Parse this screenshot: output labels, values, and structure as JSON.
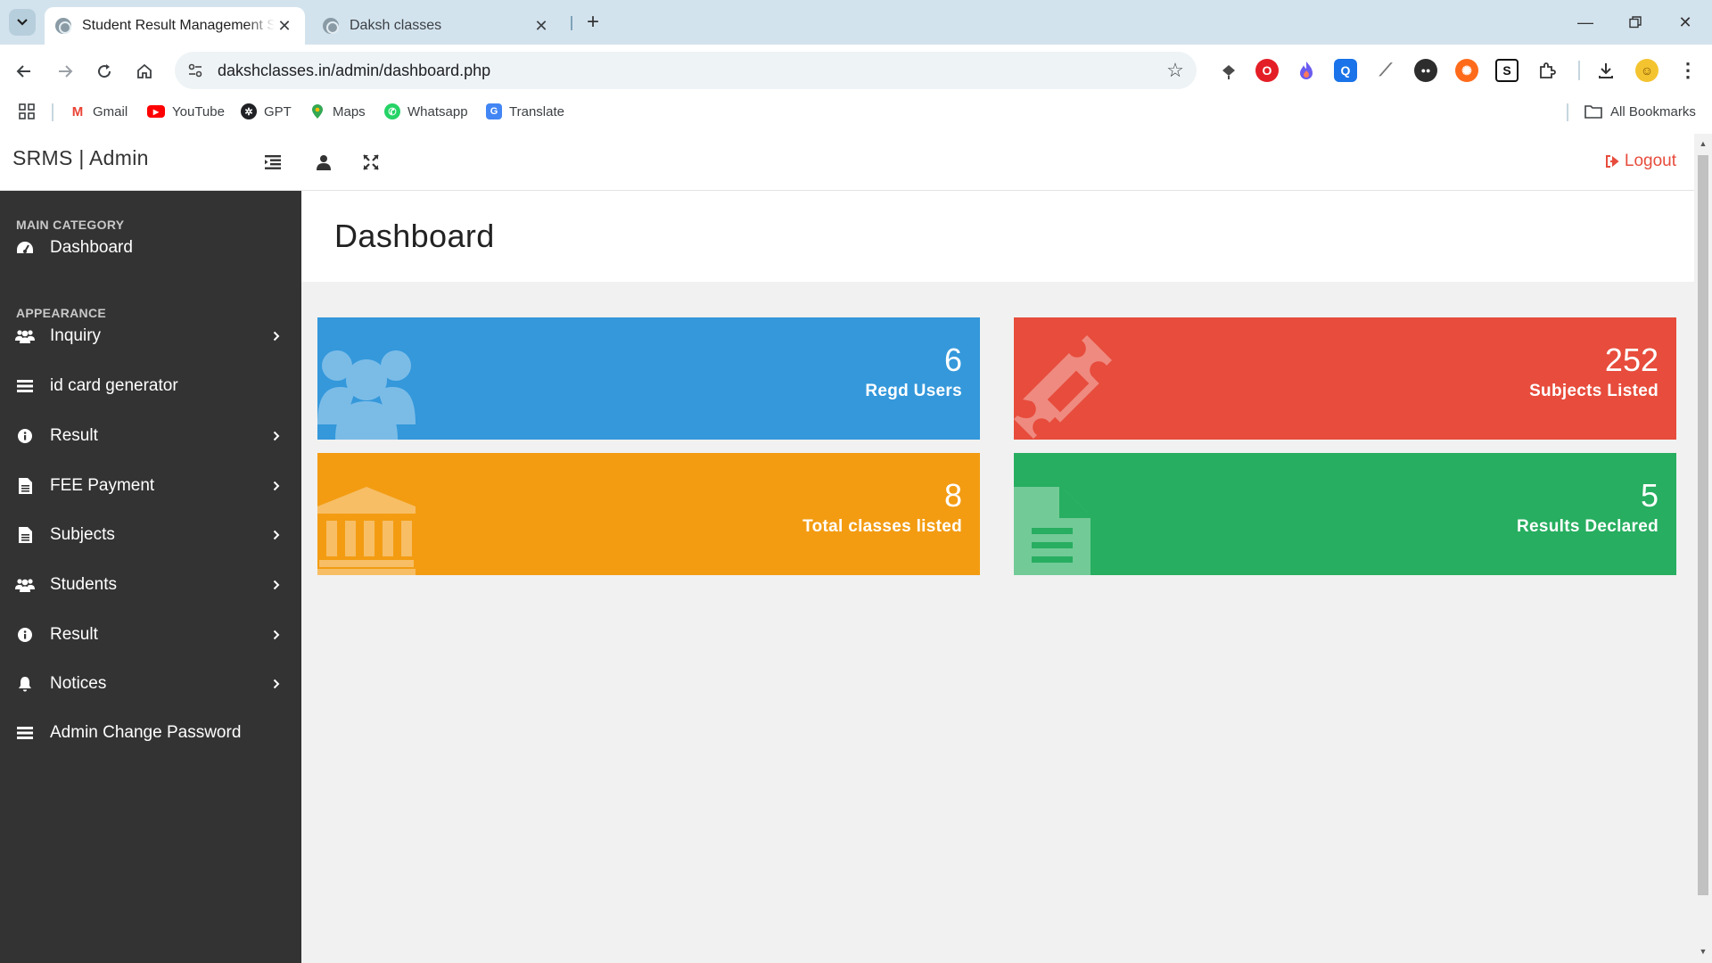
{
  "browser": {
    "tabs": [
      {
        "title": "Student Result Management Sy",
        "active": true
      },
      {
        "title": "Daksh classes",
        "active": false
      }
    ],
    "url": "dakshclasses.in/admin/dashboard.php",
    "bookmarks": [
      {
        "label": "Gmail",
        "icon": "gmail-icon",
        "color": "#ea4335"
      },
      {
        "label": "YouTube",
        "icon": "youtube-icon",
        "color": "#ff0000"
      },
      {
        "label": "GPT",
        "icon": "openai-icon",
        "color": "#202124"
      },
      {
        "label": "Maps",
        "icon": "maps-pin-icon",
        "color": "#34a853"
      },
      {
        "label": "Whatsapp",
        "icon": "whatsapp-icon",
        "color": "#25d366"
      },
      {
        "label": "Translate",
        "icon": "translate-icon",
        "color": "#4285f4"
      }
    ],
    "all_bookmarks": "All Bookmarks"
  },
  "app": {
    "brand": "SRMS | Admin",
    "logout": "Logout",
    "page_title": "Dashboard"
  },
  "sidebar": {
    "categories": [
      "MAIN CATEGORY",
      "APPEARANCE"
    ],
    "items": [
      {
        "label": "Dashboard",
        "icon": "dashboard-gauge-icon",
        "chevron": false
      },
      {
        "label": "Inquiry",
        "icon": "users-icon",
        "chevron": true
      },
      {
        "label": "id card generator",
        "icon": "list-icon",
        "chevron": false
      },
      {
        "label": "Result",
        "icon": "info-circle-icon",
        "chevron": true
      },
      {
        "label": "FEE Payment",
        "icon": "file-text-icon",
        "chevron": true
      },
      {
        "label": "Subjects",
        "icon": "file-text-icon",
        "chevron": true
      },
      {
        "label": "Students",
        "icon": "users-icon",
        "chevron": true
      },
      {
        "label": "Result",
        "icon": "info-circle-icon",
        "chevron": true
      },
      {
        "label": "Notices",
        "icon": "bell-icon",
        "chevron": true
      },
      {
        "label": "Admin Change Password",
        "icon": "list-icon",
        "chevron": false
      }
    ]
  },
  "cards": [
    {
      "value": "6",
      "label": "Regd Users",
      "color": "#3498db",
      "icon": "users-icon"
    },
    {
      "value": "252",
      "label": "Subjects Listed",
      "color": "#e74c3c",
      "icon": "ticket-icon"
    },
    {
      "value": "8",
      "label": "Total classes listed",
      "color": "#f39c12",
      "icon": "bank-icon"
    },
    {
      "value": "5",
      "label": "Results Declared",
      "color": "#27ae60",
      "icon": "file-text-icon"
    }
  ]
}
